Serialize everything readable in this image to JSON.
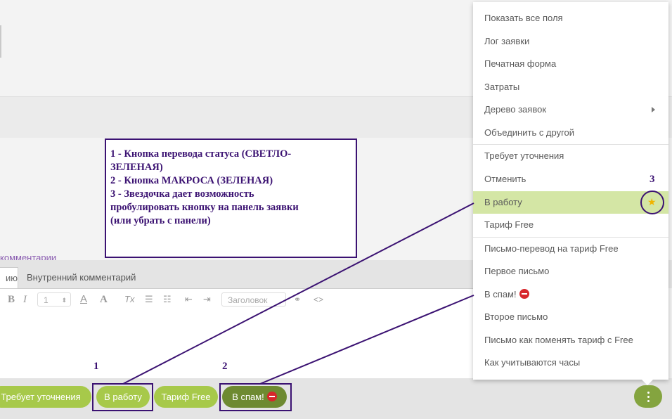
{
  "background": {
    "comments_link": "комментарии",
    "tabs": [
      "ию",
      "Внутренний комментарий"
    ],
    "toolbar": {
      "bold": "B",
      "italic": "I",
      "font_size_value": "1",
      "font_color": "A",
      "bg_color": "A",
      "clear_format": "Tx",
      "heading_placeholder": "Заголовок",
      "code": "<>"
    }
  },
  "bottom_bar": {
    "buttons": [
      "Требует уточнения",
      "В работу",
      "Тариф Free",
      "В спам!"
    ]
  },
  "annotation": {
    "lines": [
      "1 - Кнопка перевода статуса (СВЕТЛО-",
      "ЗЕЛЕНАЯ)",
      "2 - Кнопка МАКРОСА (ЗЕЛЕНАЯ)",
      "3 - Звездочка дает возможность",
      "пробулировать кнопку на панель заявки",
      "(или убрать с панели)"
    ],
    "markers": [
      "1",
      "2",
      "3"
    ]
  },
  "menu": {
    "items": [
      "Показать все поля",
      "Лог заявки",
      "Печатная форма",
      "Затраты",
      "Дерево заявок",
      "Объединить с другой",
      "Требует уточнения",
      "Отменить",
      "В работу",
      "Тариф Free",
      "Письмо-перевод на тариф Free",
      "Первое письмо",
      "В спам!",
      "Второе письмо",
      "Письмо как поменять тариф с Free",
      "Как учитываются часы"
    ],
    "active_item": "В работу"
  },
  "colors": {
    "status_button": "#a7c94a",
    "macro_button": "#6e8a31",
    "annotation": "#3b1272",
    "active_menu": "#d4e6a5"
  },
  "icons": [
    "stop-sign-icon",
    "star-icon",
    "chevron-right-icon",
    "more-vertical-icon"
  ]
}
